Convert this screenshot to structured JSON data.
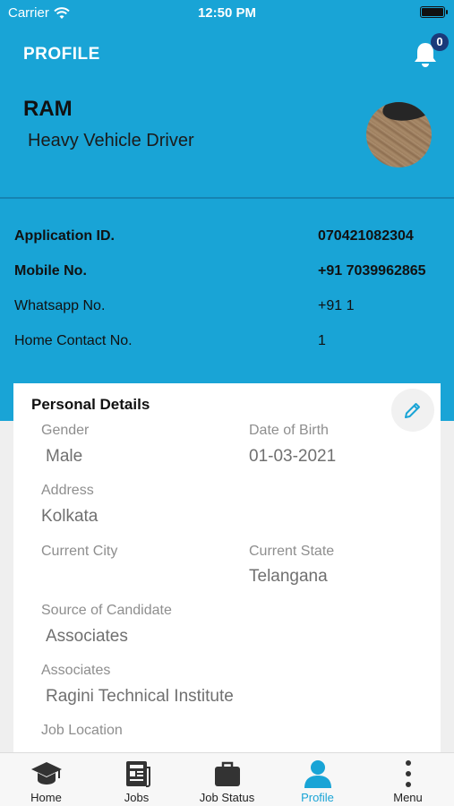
{
  "status_bar": {
    "carrier": "Carrier",
    "time": "12:50 PM"
  },
  "header": {
    "title": "PROFILE",
    "notification_count": "0"
  },
  "profile": {
    "name": "RAM",
    "role": "Heavy Vehicle Driver"
  },
  "info": [
    {
      "label": "Application ID.",
      "value": "070421082304"
    },
    {
      "label": "Mobile No.",
      "value": "+91 7039962865"
    },
    {
      "label": "Whatsapp No.",
      "value": "+91 1"
    },
    {
      "label": "Home Contact No.",
      "value": "1"
    }
  ],
  "personal_details": {
    "title": "Personal Details",
    "gender": {
      "label": "Gender",
      "value": "Male"
    },
    "dob": {
      "label": "Date of Birth",
      "value": "01-03-2021"
    },
    "address": {
      "label": "Address",
      "value": "Kolkata"
    },
    "current_city": {
      "label": "Current City",
      "value": ""
    },
    "current_state": {
      "label": "Current State",
      "value": "Telangana"
    },
    "source": {
      "label": "Source of Candidate",
      "value": "Associates"
    },
    "associates": {
      "label": "Associates",
      "value": "Ragini Technical Institute"
    },
    "job_location": {
      "label": "Job Location"
    }
  },
  "tabs": [
    {
      "label": "Home",
      "icon": "graduation-cap-icon"
    },
    {
      "label": "Jobs",
      "icon": "newspaper-icon"
    },
    {
      "label": "Job Status",
      "icon": "briefcase-icon"
    },
    {
      "label": "Profile",
      "icon": "user-icon",
      "active": true
    },
    {
      "label": "Menu",
      "icon": "more-vertical-icon"
    }
  ],
  "colors": {
    "primary": "#19a4d6",
    "badge": "#1a3a7a",
    "active_tab": "#19a4d6"
  }
}
